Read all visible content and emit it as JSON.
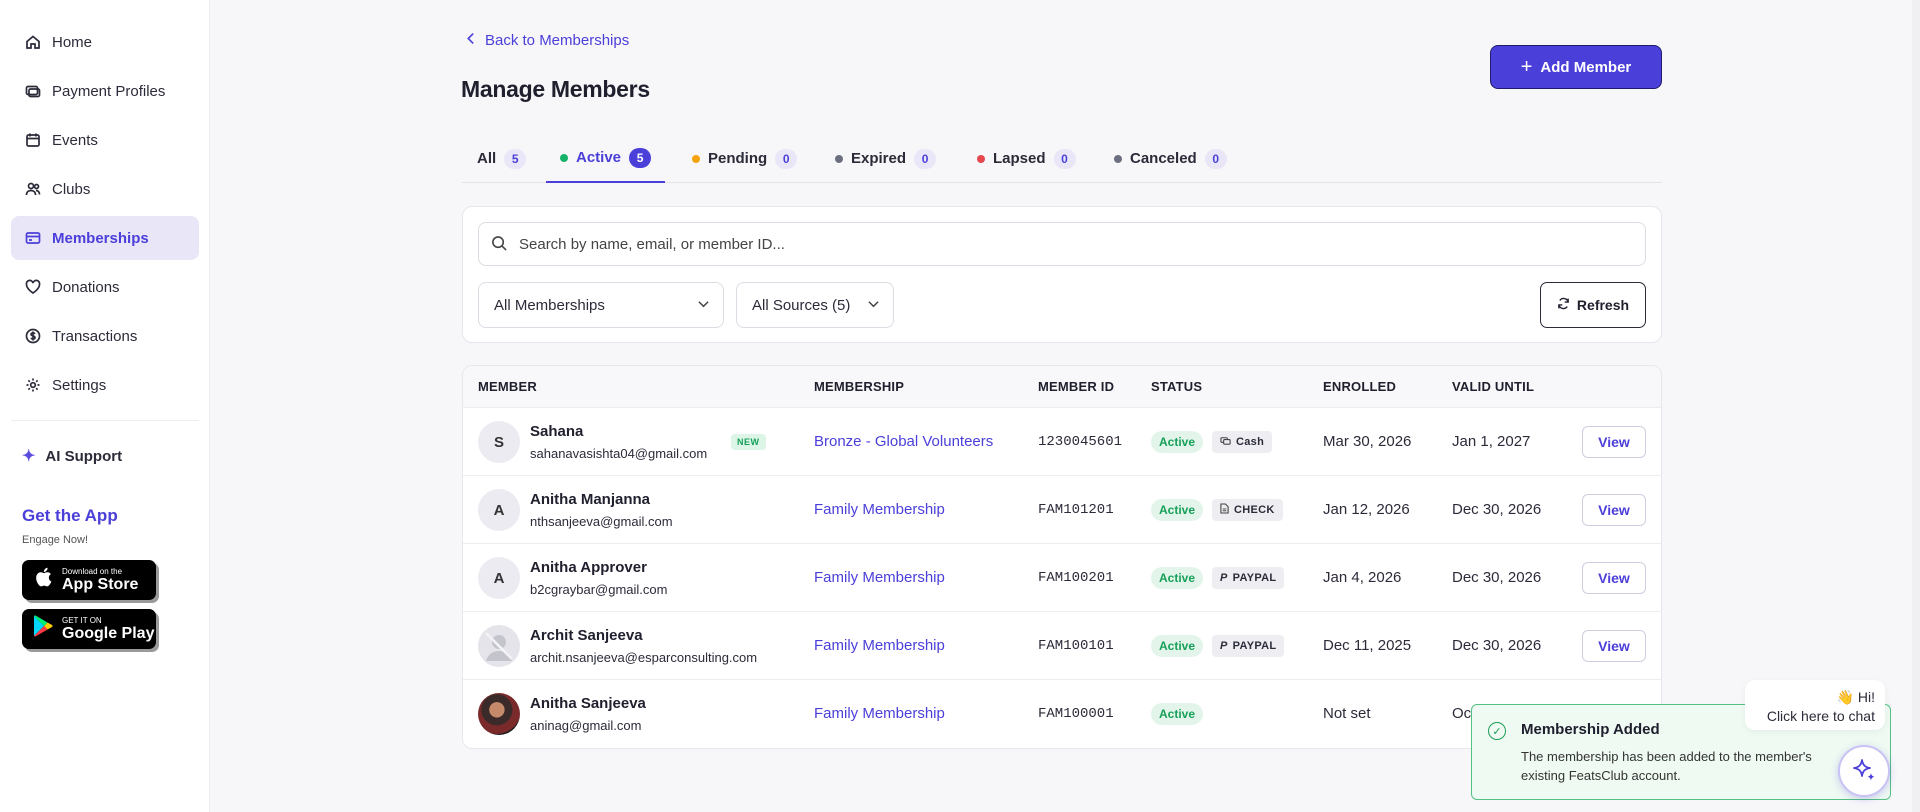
{
  "sidebar": {
    "items": [
      {
        "label": "Home",
        "icon": "home-icon"
      },
      {
        "label": "Payment Profiles",
        "icon": "credit-card-icon"
      },
      {
        "label": "Events",
        "icon": "calendar-icon"
      },
      {
        "label": "Clubs",
        "icon": "users-icon"
      },
      {
        "label": "Memberships",
        "icon": "membership-card-icon",
        "active": true
      },
      {
        "label": "Donations",
        "icon": "heart-icon"
      },
      {
        "label": "Transactions",
        "icon": "dollar-circle-icon"
      },
      {
        "label": "Settings",
        "icon": "gear-icon"
      }
    ],
    "ai_support": "AI Support",
    "get_app": "Get the App",
    "engage": "Engage Now!",
    "app_store": {
      "small": "Download on the",
      "big": "App Store"
    },
    "google_play": {
      "small": "GET IT ON",
      "big": "Google Play"
    }
  },
  "header": {
    "back_label": "Back to Memberships",
    "title": "Manage Members",
    "add_label": "Add Member"
  },
  "tabs": [
    {
      "label": "All",
      "count": "5",
      "dot": ""
    },
    {
      "label": "Active",
      "count": "5",
      "dot": "#17b26a",
      "active": true
    },
    {
      "label": "Pending",
      "count": "0",
      "dot": "#f5a30a"
    },
    {
      "label": "Expired",
      "count": "0",
      "dot": "#6b6f80"
    },
    {
      "label": "Lapsed",
      "count": "0",
      "dot": "#e5484d"
    },
    {
      "label": "Canceled",
      "count": "0",
      "dot": "#6b6f80"
    }
  ],
  "filters": {
    "search_placeholder": "Search by name, email, or member ID...",
    "membership_select": "All Memberships",
    "source_select": "All Sources (5)",
    "refresh_label": "Refresh"
  },
  "table": {
    "headers": {
      "member": "MEMBER",
      "membership": "MEMBERSHIP",
      "member_id": "MEMBER ID",
      "status": "STATUS",
      "enrolled": "ENROLLED",
      "valid_until": "VALID UNTIL"
    },
    "view_label": "View",
    "new_label": "NEW",
    "rows": [
      {
        "initial": "S",
        "avatar": "initial",
        "name": "Sahana",
        "email": "sahanavasishta04@gmail.com",
        "new": true,
        "membership": "Bronze - Global Volunteers",
        "member_id": "1230045601",
        "status": "Active",
        "source": "Cash",
        "source_icon": "cash-icon",
        "enrolled": "Mar 30, 2026",
        "valid_until": "Jan 1, 2027"
      },
      {
        "initial": "A",
        "avatar": "initial",
        "name": "Anitha Manjanna",
        "email": "nthsanjeeva@gmail.com",
        "new": false,
        "membership": "Family Membership",
        "member_id": "FAM101201",
        "status": "Active",
        "source": "CHECK",
        "source_icon": "document-icon",
        "enrolled": "Jan 12, 2026",
        "valid_until": "Dec 30, 2026"
      },
      {
        "initial": "A",
        "avatar": "initial",
        "name": "Anitha Approver",
        "email": "b2cgraybar@gmail.com",
        "new": false,
        "membership": "Family Membership",
        "member_id": "FAM100201",
        "status": "Active",
        "source": "PAYPAL",
        "source_icon": "paypal-icon",
        "enrolled": "Jan 4, 2026",
        "valid_until": "Dec 30, 2026"
      },
      {
        "initial": "",
        "avatar": "ghost",
        "name": "Archit Sanjeeva",
        "email": "archit.nsanjeeva@esparconsulting.com",
        "new": false,
        "membership": "Family Membership",
        "member_id": "FAM100101",
        "status": "Active",
        "source": "PAYPAL",
        "source_icon": "paypal-icon",
        "enrolled": "Dec 11, 2025",
        "valid_until": "Dec 30, 2026"
      },
      {
        "initial": "",
        "avatar": "photo",
        "name": "Anitha Sanjeeva",
        "email": "aninag@gmail.com",
        "new": false,
        "membership": "Family Membership",
        "member_id": "FAM100001",
        "status": "Active",
        "source": "",
        "source_icon": "",
        "enrolled": "Not set",
        "valid_until": "Oc"
      }
    ]
  },
  "toast": {
    "title": "Membership Added",
    "body": "The membership has been added to the member's existing FeatsClub account."
  },
  "chat": {
    "greeting": "👋 Hi!",
    "prompt": "Click here to chat"
  },
  "colors": {
    "accent": "#4b3fd9",
    "active_green": "#17a05a"
  }
}
